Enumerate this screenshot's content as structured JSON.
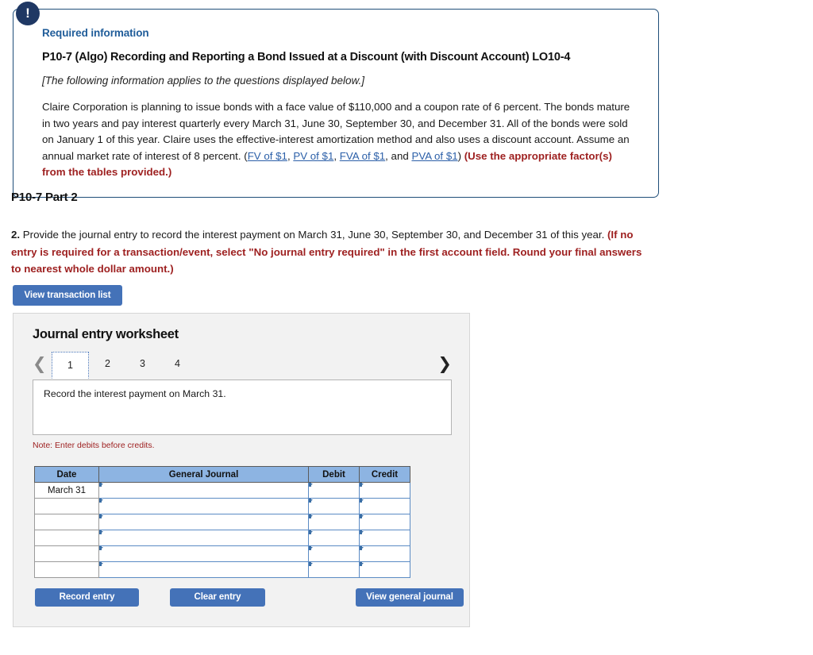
{
  "required_info": {
    "badge_icon": "exclamation-icon",
    "label": "Required information",
    "title": "P10-7 (Algo) Recording and Reporting a Bond Issued at a Discount (with Discount Account) LO10-4",
    "applies_note": "[The following information applies to the questions displayed below.]",
    "body_part1": "Claire Corporation is planning to issue bonds with a face value of $110,000 and a coupon rate of 6 percent. The bonds mature in two years and pay interest quarterly every March 31, June 30, September 30, and December 31. All of the bonds were sold on January 1 of this year. Claire uses the effective-interest amortization method and also uses a discount account. Assume an annual market rate of interest of 8 percent. (",
    "links": [
      "FV of $1",
      "PV of $1",
      "FVA of $1",
      "PVA of $1"
    ],
    "body_sep1": ", ",
    "body_sep2": ", ",
    "body_sep3": ", and ",
    "body_close": ") ",
    "body_red": "(Use the appropriate factor(s) from the tables provided.)"
  },
  "part": {
    "heading": "P10-7 Part 2",
    "question_number": "2.",
    "question_text": " Provide the journal entry to record the interest payment on March 31, June 30, September 30, and December 31 of this year. ",
    "question_red": "(If no entry is required for a transaction/event, select \"No journal entry required\" in the first account field. Round your final answers to nearest whole dollar amount.)"
  },
  "toolbar": {
    "view_transaction_list": "View transaction list"
  },
  "worksheet": {
    "title": "Journal entry worksheet",
    "prev_icon": "chevron-left-icon",
    "next_icon": "chevron-right-icon",
    "tabs": [
      {
        "label": "1",
        "active": true
      },
      {
        "label": "2",
        "active": false
      },
      {
        "label": "3",
        "active": false
      },
      {
        "label": "4",
        "active": false
      }
    ],
    "description": "Record the interest payment on March 31.",
    "note": "Note: Enter debits before credits.",
    "table": {
      "headers": [
        "Date",
        "General Journal",
        "Debit",
        "Credit"
      ],
      "rows": [
        {
          "date": "March 31",
          "general_journal": "",
          "debit": "",
          "credit": ""
        },
        {
          "date": "",
          "general_journal": "",
          "debit": "",
          "credit": ""
        },
        {
          "date": "",
          "general_journal": "",
          "debit": "",
          "credit": ""
        },
        {
          "date": "",
          "general_journal": "",
          "debit": "",
          "credit": ""
        },
        {
          "date": "",
          "general_journal": "",
          "debit": "",
          "credit": ""
        },
        {
          "date": "",
          "general_journal": "",
          "debit": "",
          "credit": ""
        }
      ]
    },
    "buttons": {
      "record_entry": "Record entry",
      "clear_entry": "Clear entry",
      "view_general_journal": "View general journal"
    }
  },
  "colors": {
    "accent_blue": "#4472b8",
    "box_border": "#1f4e79",
    "badge_navy": "#1f3864",
    "table_header_blue": "#8db4e2",
    "red_bold": "#9e2121",
    "link_blue": "#2b5fa8"
  }
}
